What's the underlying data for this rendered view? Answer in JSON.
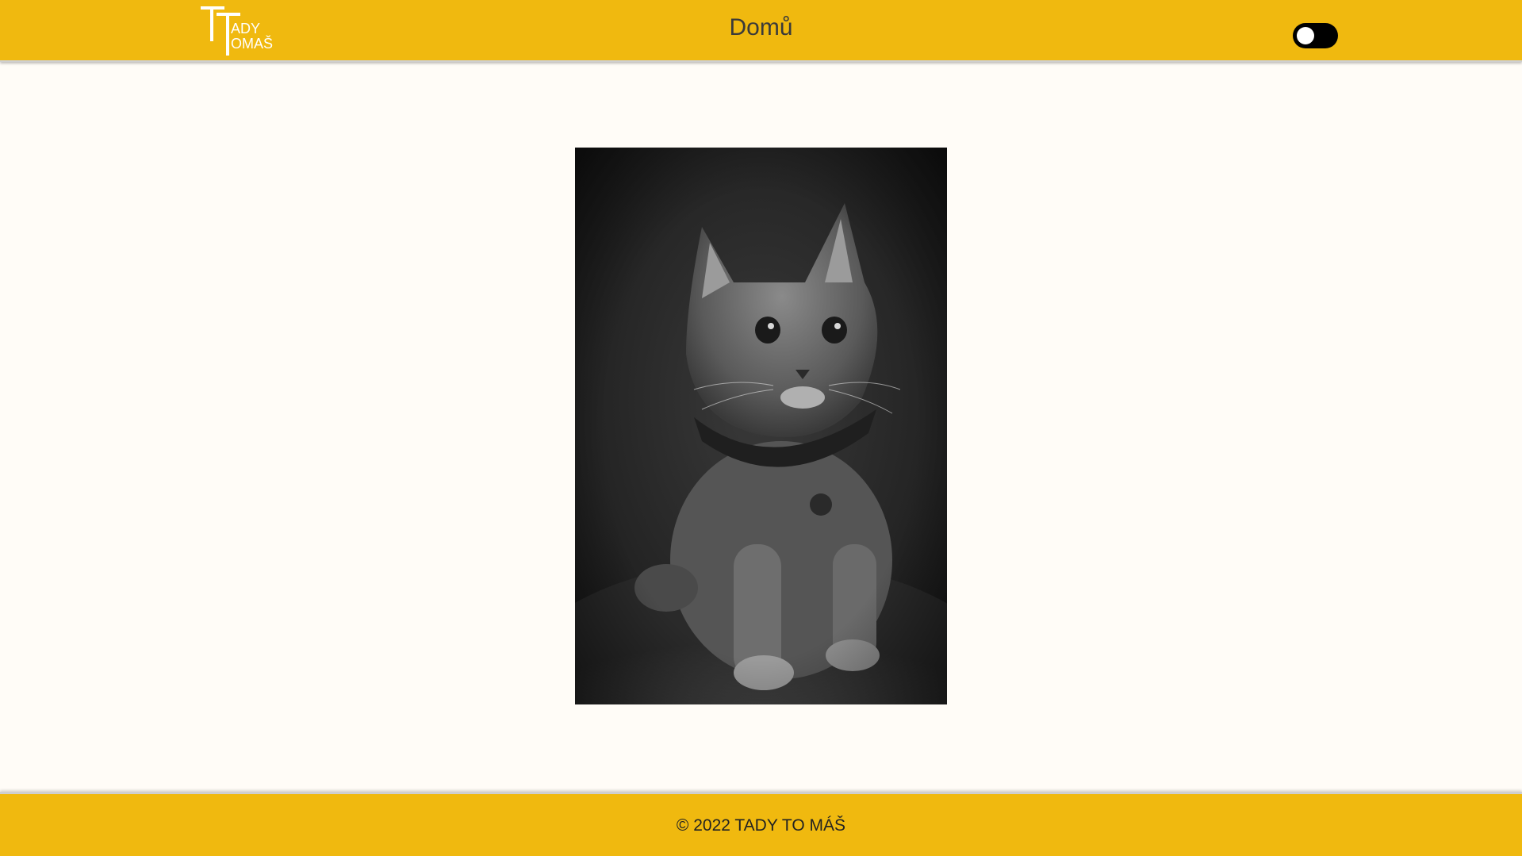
{
  "header": {
    "logo": {
      "icon": "tady-tomas-logo",
      "line1": "ADY",
      "line2": "OMAŠ",
      "color": "#ffffff"
    },
    "nav_title": "Domů",
    "theme_toggle": {
      "icon": "dark-mode-toggle",
      "state": "off"
    },
    "background": "#f0b90f"
  },
  "main": {
    "image": {
      "subject": "grayscale-kitten-photo",
      "alt": ""
    }
  },
  "footer": {
    "copyright": "© 2022 TADY TO MÁŠ"
  }
}
